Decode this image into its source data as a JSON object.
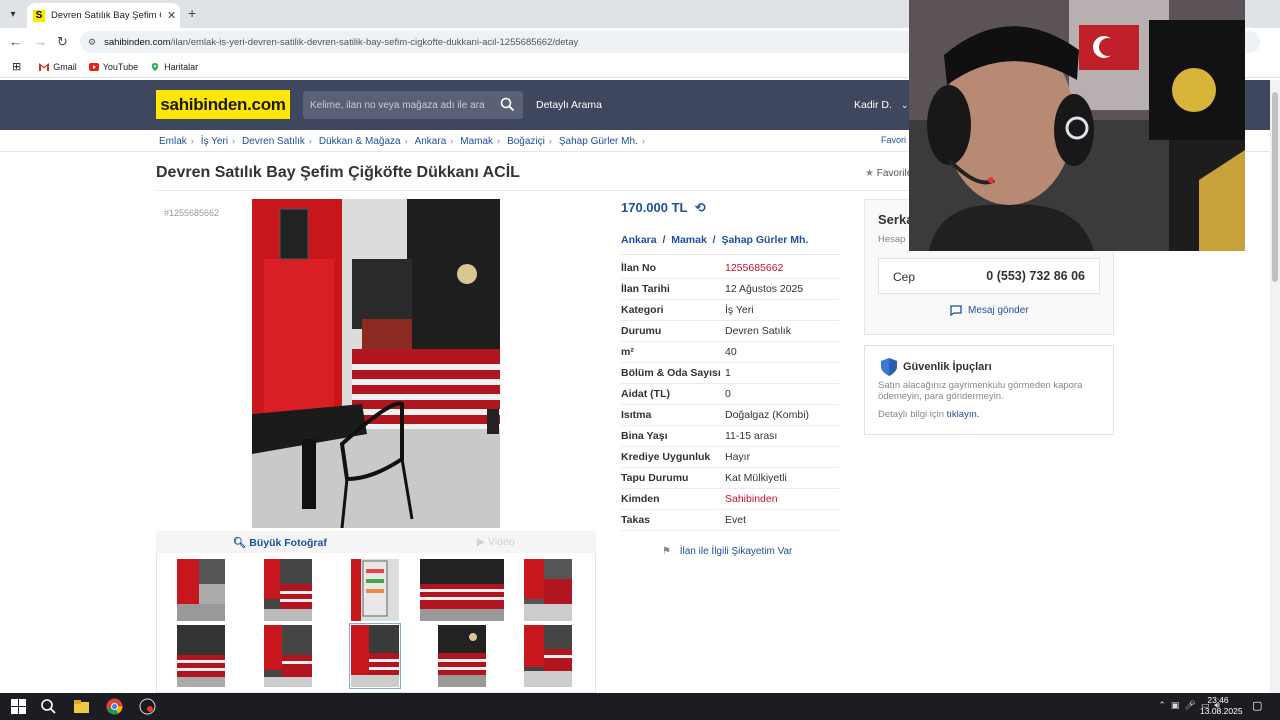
{
  "browser": {
    "tab_title": "Devren Satılık Bay Şefim Çiğköfte",
    "favicon_letter": "S",
    "url_host": "sahibinden.com",
    "url_path": "/ilan/emlak-is-yeri-devren-satilik-devren-satilik-bay-sefim-cigkofte-dukkani-acil-1255685662/detay",
    "bookmarks": [
      "Gmail",
      "YouTube",
      "Haritalar"
    ]
  },
  "header": {
    "logo": "sahibinden.com",
    "search_placeholder": "Kelime, ilan no veya mağaza adı ile ara",
    "advanced_search": "Detaylı Arama",
    "user": "Kadir D."
  },
  "breadcrumb": [
    "Emlak",
    "İş Yeri",
    "Devren Satılık",
    "Dükkan & Mağaza",
    "Ankara",
    "Mamak",
    "Boğaziçi",
    "Şahap Gürler Mh."
  ],
  "breadcrumb_right": "Favori İ",
  "listing": {
    "title": "Devren Satılık Bay Şefim Çiğköfte Dükkanı ACİL",
    "favorite_label": "Favorile",
    "ad_id_tag": "#1255685662",
    "big_photo": "Büyük Fotoğraf",
    "video": "Video",
    "price": "170.000 TL",
    "location": [
      "Ankara",
      "Mamak",
      "Şahap Gürler Mh."
    ],
    "details": [
      {
        "k": "İlan No",
        "v": "1255685662",
        "red": true
      },
      {
        "k": "İlan Tarihi",
        "v": "12 Ağustos 2025"
      },
      {
        "k": "Kategori",
        "v": "İş Yeri"
      },
      {
        "k": "Durumu",
        "v": "Devren Satılık"
      },
      {
        "k": "m²",
        "v": "40"
      },
      {
        "k": "Bölüm & Oda Sayısı",
        "v": "1"
      },
      {
        "k": "Aidat (TL)",
        "v": "0"
      },
      {
        "k": "Isıtma",
        "v": "Doğalgaz (Kombi)"
      },
      {
        "k": "Bina Yaşı",
        "v": "11-15 arası"
      },
      {
        "k": "Krediye Uygunluk",
        "v": "Hayır"
      },
      {
        "k": "Tapu Durumu",
        "v": "Kat Mülkiyetli"
      },
      {
        "k": "Kimden",
        "v": "Sahibinden",
        "red": true
      },
      {
        "k": "Takas",
        "v": "Evet"
      }
    ],
    "complaint": "İlan ile İlgili Şikayetim Var"
  },
  "seller": {
    "name": "Serka",
    "sub": "Hesap",
    "phone_label": "Cep",
    "phone": "0 (553) 732 86 06",
    "message": "Mesaj gönder"
  },
  "security": {
    "title": "Güvenlik İpuçları",
    "text": "Satın alacağınız gayrimenkulu görmeden kapora ödemeyin, para göndermeyin.",
    "more_prefix": "Detaylı bilgi için ",
    "more_link": "tıklayın."
  },
  "taskbar": {
    "time": "23:46",
    "date": "13.08.2025"
  },
  "colors": {
    "header_bg": "#3f475f",
    "logo_bg": "#ffe800",
    "link_blue": "#1e4fa2",
    "accent_red": "#c8102e"
  }
}
